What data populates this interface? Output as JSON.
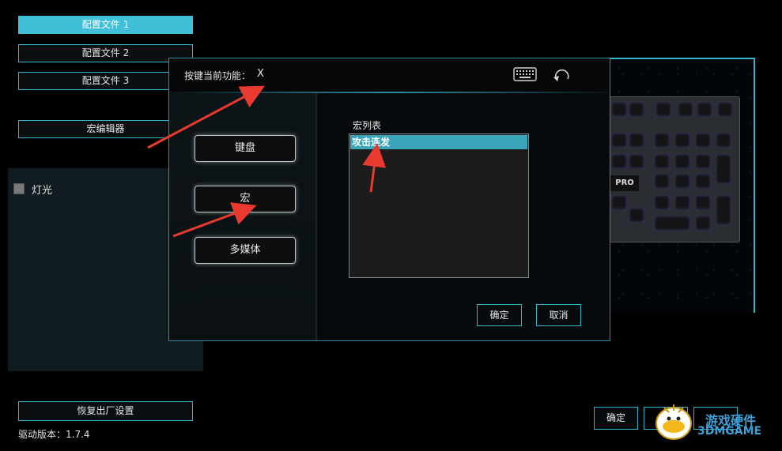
{
  "profiles": [
    {
      "label": "配置文件 1",
      "active": true
    },
    {
      "label": "配置文件 2",
      "active": false
    },
    {
      "label": "配置文件 3",
      "active": false
    }
  ],
  "macro_editor_label": "宏编辑器",
  "light_checkbox_label": "灯光",
  "factory_reset_label": "恢复出厂设置",
  "driver_version": "驱动版本：1.7.4",
  "dialog": {
    "title_prefix": "按键当前功能：",
    "title_value": "X",
    "function_buttons": [
      "键盘",
      "宏",
      "多媒体"
    ],
    "macro_list_label": "宏列表",
    "macro_list_items": [
      "攻击连发"
    ],
    "ok_label": "确定",
    "cancel_label": "取消"
  },
  "main_ok_label": "确定",
  "keyboard_badge": "PRO",
  "watermark": {
    "text_top": "游戏硬件",
    "text_bottom": "3DMGAME"
  },
  "colors": {
    "accent": "#33b6c9",
    "active_fill": "#40c0d8",
    "annotation": "#e83a2f"
  }
}
